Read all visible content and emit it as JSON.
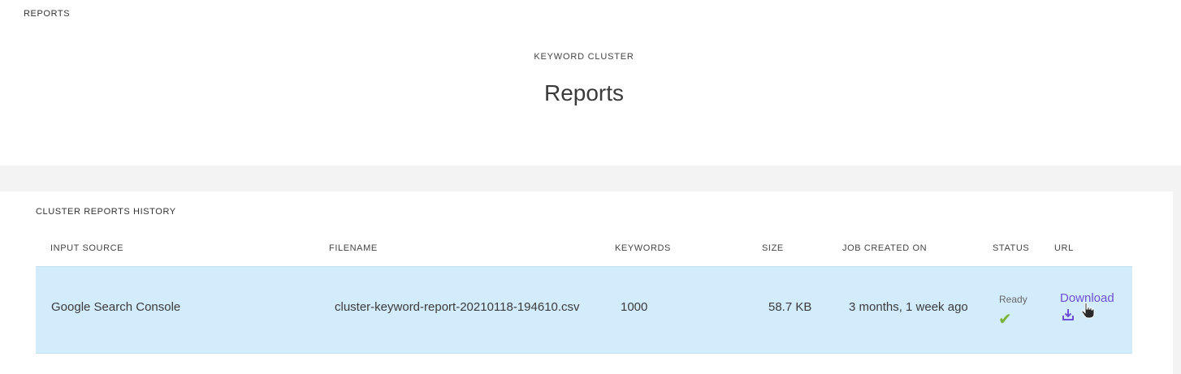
{
  "breadcrumb": "REPORTS",
  "header": {
    "subtitle": "KEYWORD CLUSTER",
    "title": "Reports"
  },
  "history": {
    "title": "CLUSTER REPORTS HISTORY",
    "columns": [
      "INPUT SOURCE",
      "FILENAME",
      "KEYWORDS",
      "SIZE",
      "JOB CREATED ON",
      "STATUS",
      "URL"
    ],
    "rows": [
      {
        "input_source": "Google Search Console",
        "filename": "cluster-keyword-report-20210118-194610.csv",
        "keywords": "1000",
        "size": "58.7 KB",
        "created": "3 months, 1 week ago",
        "status": "Ready",
        "status_icon": "check-icon",
        "url_label": "Download",
        "url_icon": "download-icon"
      }
    ]
  },
  "colors": {
    "row_highlight": "#d3ecfb",
    "link": "#6f4fd6",
    "success": "#7bb33a",
    "band": "#f3f3f3"
  }
}
